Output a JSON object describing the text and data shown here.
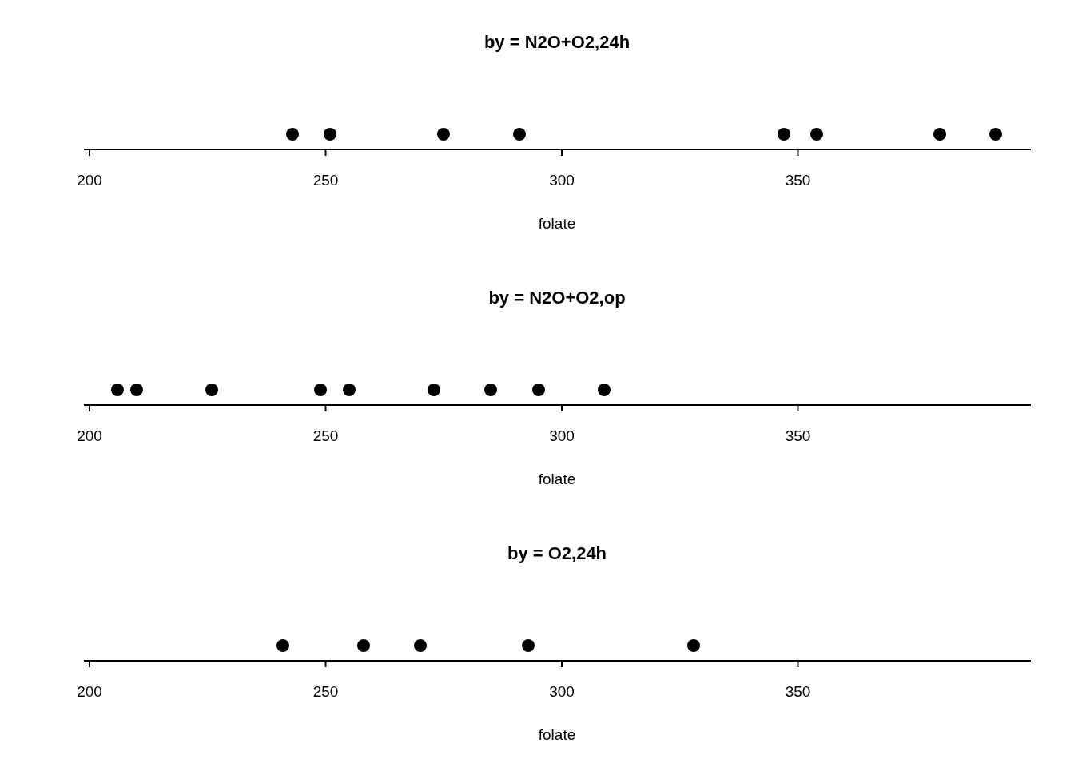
{
  "panels": [
    {
      "title": "by = N2O+O2,24h",
      "ticks": [
        "200",
        "250",
        "300",
        "350"
      ],
      "axis_label": "folate"
    },
    {
      "title": "by = N2O+O2,op",
      "ticks": [
        "200",
        "250",
        "300",
        "350"
      ],
      "axis_label": "folate"
    },
    {
      "title": "by = O2,24h",
      "ticks": [
        "200",
        "250",
        "300",
        "350"
      ],
      "axis_label": "folate"
    }
  ]
}
